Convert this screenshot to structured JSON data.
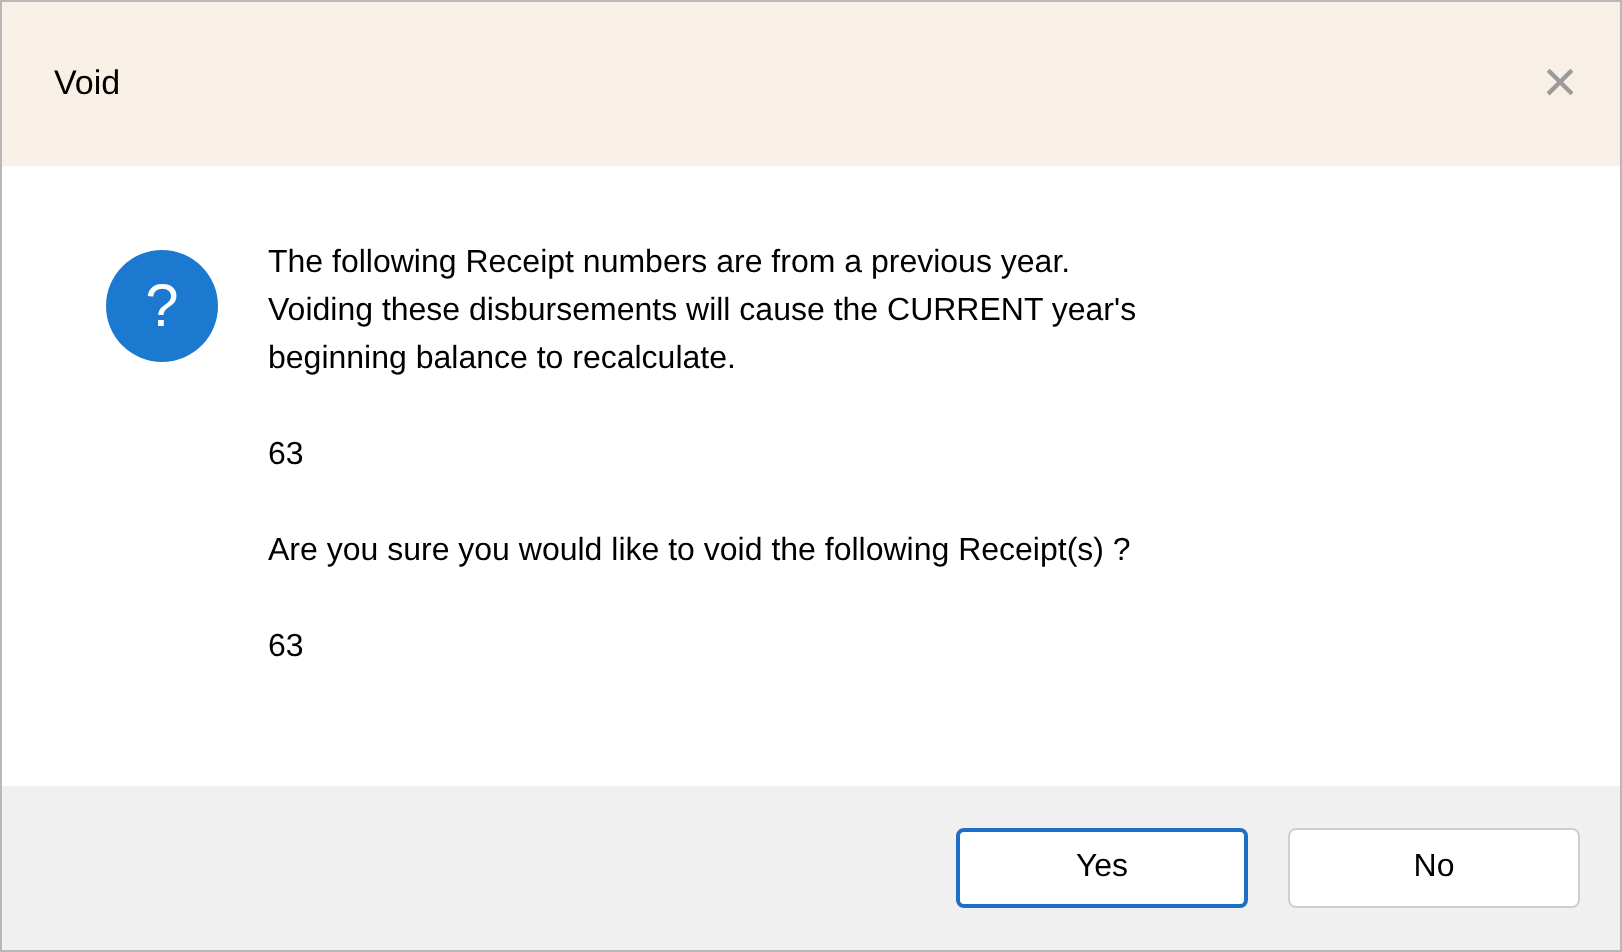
{
  "window": {
    "title": "Void",
    "close": "×"
  },
  "message": {
    "icon": "?",
    "lines": [
      "The following Receipt numbers are from a previous year.",
      "Voiding these disbursements will cause the CURRENT year's",
      "beginning balance to recalculate."
    ],
    "first_list": "63",
    "question": "Are you sure you would like to void the following Receipt(s) ?",
    "second_list": "63"
  },
  "buttons": [
    {
      "label": "Yes",
      "selected": true
    },
    {
      "label": "No",
      "selected": false
    }
  ]
}
